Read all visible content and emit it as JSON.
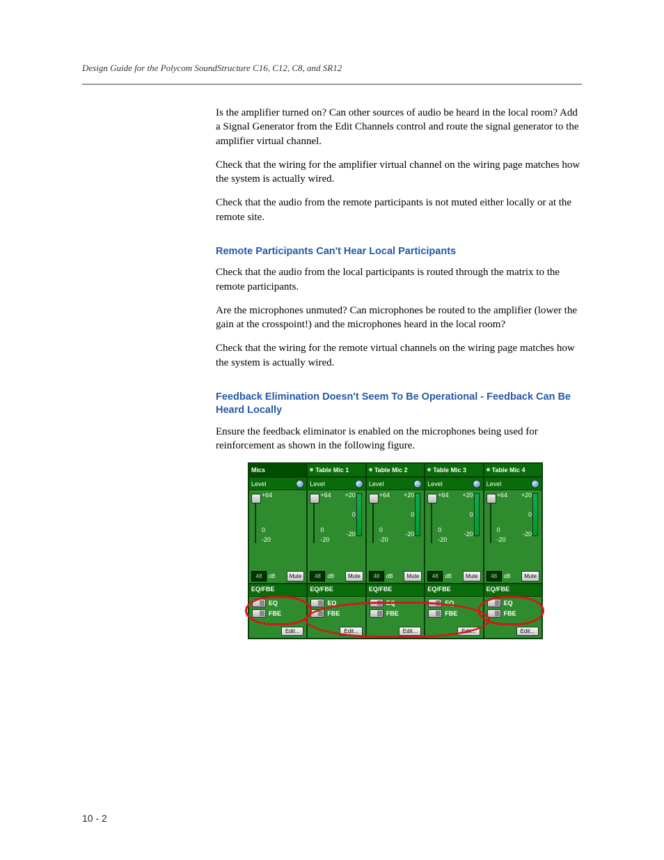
{
  "header": {
    "running_head": "Design Guide for the Polycom SoundStructure C16, C12, C8, and SR12"
  },
  "body": {
    "p1": "Is the amplifier turned on? Can other sources of audio be heard in the local room? Add a Signal Generator from the Edit Channels control and route the signal generator to the amplifier virtual channel.",
    "p2": "Check that the wiring for the amplifier virtual channel on the wiring page matches how the system is actually wired.",
    "p3": "Check that the audio from the remote participants is not muted either locally or at the remote site.",
    "h1": "Remote Participants Can't Hear Local Participants",
    "p4": "Check that the audio from the local participants is routed through the matrix to the remote participants.",
    "p5": "Are the microphones unmuted? Can microphones be routed to the amplifier (lower the gain at the crosspoint!) and the microphones heard in the local room?",
    "p6": "Check that the wiring for the remote virtual channels on the wiring page matches how the system is actually wired.",
    "h2": "Feedback Elimination Doesn't Seem To Be Operational - Feedback Can Be Heard Locally",
    "p7": "Ensure the feedback eliminator is enabled on the microphones being used for reinforcement as shown in the following figure."
  },
  "figure": {
    "labels": {
      "level": "Level",
      "eqfbe": "EQ/FBE",
      "eq": "EQ",
      "fbe": "FBE",
      "edit": "Edit...",
      "mute": "Mute",
      "db": "dB",
      "p64": "+64",
      "zero": "0",
      "m20": "-20",
      "p20": "+20",
      "val": "48"
    },
    "channels": [
      {
        "title": "Mics",
        "has_meter": false
      },
      {
        "title": "Table Mic 1",
        "has_meter": true
      },
      {
        "title": "Table Mic 2",
        "has_meter": true
      },
      {
        "title": "Table Mic 3",
        "has_meter": true
      },
      {
        "title": "Table Mic 4",
        "has_meter": true
      }
    ]
  },
  "page_number": "10 - 2"
}
